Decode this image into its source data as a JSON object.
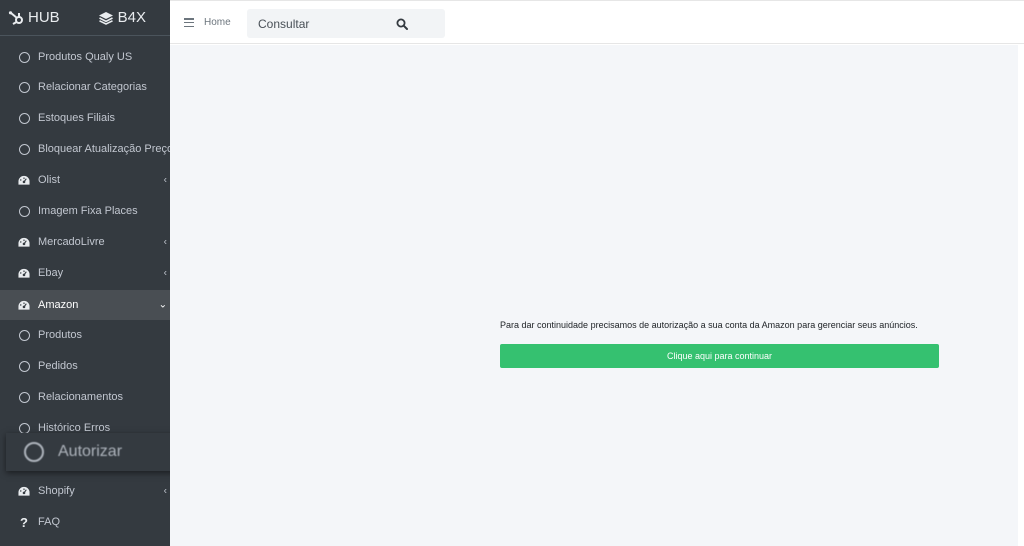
{
  "sidebar": {
    "brand": {
      "hub": "HUB",
      "b4x": "B4X"
    },
    "items": [
      {
        "label": "Produtos Qualy US",
        "icon": "circle-icon",
        "chevron": ""
      },
      {
        "label": "Relacionar Categorias",
        "icon": "circle-icon",
        "chevron": ""
      },
      {
        "label": "Estoques Filiais",
        "icon": "circle-icon",
        "chevron": ""
      },
      {
        "label": "Bloquear Atualização Preço",
        "icon": "circle-icon",
        "chevron": ""
      },
      {
        "label": "Olist",
        "icon": "dashboard-icon",
        "chevron": "‹"
      },
      {
        "label": "Imagem Fixa Places",
        "icon": "circle-icon",
        "chevron": ""
      },
      {
        "label": "MercadoLivre",
        "icon": "dashboard-icon",
        "chevron": "‹"
      },
      {
        "label": "Ebay",
        "icon": "dashboard-icon",
        "chevron": "‹"
      },
      {
        "label": "Amazon",
        "icon": "dashboard-icon",
        "chevron": "⌄",
        "active": true
      },
      {
        "label": "Produtos",
        "icon": "circle-icon",
        "chevron": ""
      },
      {
        "label": "Pedidos",
        "icon": "circle-icon",
        "chevron": ""
      },
      {
        "label": "Relacionamentos",
        "icon": "circle-icon",
        "chevron": ""
      },
      {
        "label": "Histórico Erros",
        "icon": "circle-icon",
        "chevron": ""
      },
      {
        "label": "Shopify",
        "icon": "dashboard-icon",
        "chevron": "‹"
      },
      {
        "label": "FAQ",
        "icon": "question-icon",
        "chevron": ""
      }
    ],
    "floating_item": {
      "label": "Autorizar",
      "icon": "circle-icon"
    }
  },
  "header": {
    "home_label": "Home",
    "search_placeholder": "Consultar"
  },
  "main": {
    "message": "Para dar continuidade precisamos de autorização a sua conta da Amazon para gerenciar seus anúncios.",
    "button_label": "Clique aqui para continuar"
  },
  "colors": {
    "sidebar_bg": "#343a40",
    "content_bg": "#f4f6f9",
    "button_green": "#35c170"
  }
}
